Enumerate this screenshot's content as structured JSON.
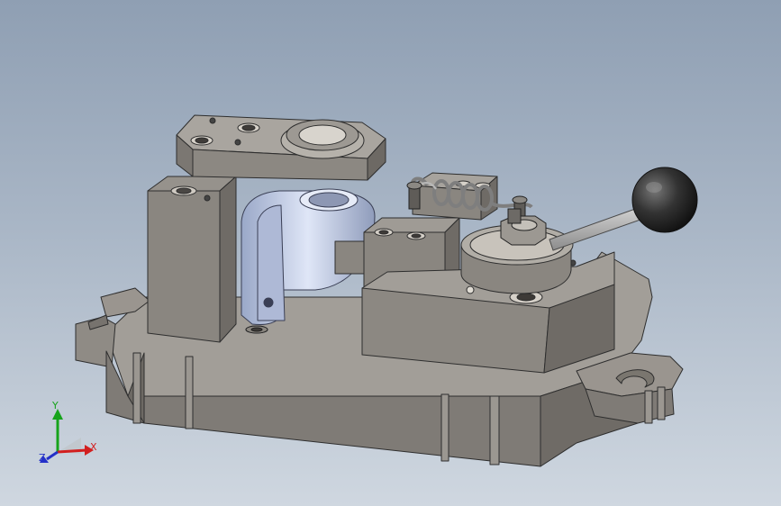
{
  "viewport": {
    "background_top": "#8f9fb3",
    "background_bottom": "#cfd7e0"
  },
  "model": {
    "part_color": "#8e8a84",
    "highlight_color": "#c3cde6",
    "handle_ball_color": "#2b2b2b"
  },
  "triad": {
    "x_label": "X",
    "y_label": "Y",
    "z_label": "Z",
    "x_color": "#d21f1f",
    "y_color": "#16a31b",
    "z_color": "#2430c8"
  }
}
